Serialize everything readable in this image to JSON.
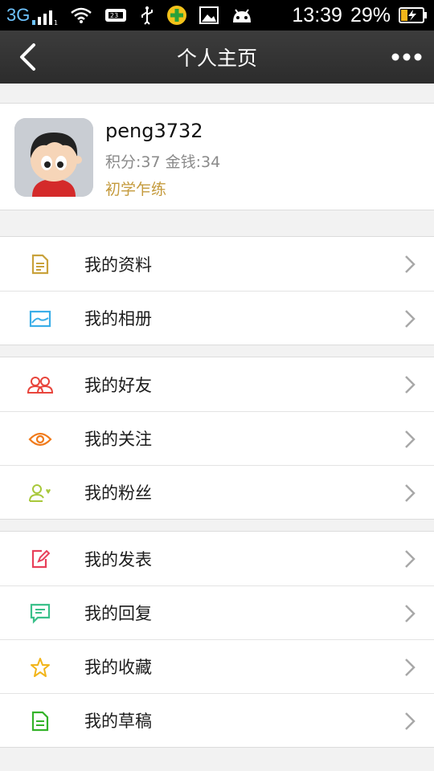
{
  "statusbar": {
    "network": "3G",
    "time": "13:39",
    "battery": "29%",
    "icons": [
      "signal-icon",
      "wifi-icon",
      "notification-icon",
      "usb-icon",
      "app-icon",
      "image-icon",
      "android-icon",
      "battery-charging-icon"
    ]
  },
  "header": {
    "title": "个人主页"
  },
  "profile": {
    "username": "peng3732",
    "stats": "积分:37 金钱:34",
    "rank": "初学乍练"
  },
  "menu": {
    "group1": [
      {
        "label": "我的资料",
        "icon": "document-icon",
        "color": "#c9a23c"
      },
      {
        "label": "我的相册",
        "icon": "photo-icon",
        "color": "#3aaee8"
      }
    ],
    "group2": [
      {
        "label": "我的好友",
        "icon": "friends-icon",
        "color": "#e8453c"
      },
      {
        "label": "我的关注",
        "icon": "eye-icon",
        "color": "#f07a1a"
      },
      {
        "label": "我的粉丝",
        "icon": "fans-icon",
        "color": "#a8c83a"
      }
    ],
    "group3": [
      {
        "label": "我的发表",
        "icon": "compose-icon",
        "color": "#e8405a"
      },
      {
        "label": "我的回复",
        "icon": "reply-icon",
        "color": "#3ac08a"
      },
      {
        "label": "我的收藏",
        "icon": "star-icon",
        "color": "#f2b51a"
      },
      {
        "label": "我的草稿",
        "icon": "draft-icon",
        "color": "#34b32a"
      }
    ]
  },
  "colors": {
    "appbar": "#333333",
    "background": "#f2f2f2",
    "rank": "#c49a3c"
  }
}
